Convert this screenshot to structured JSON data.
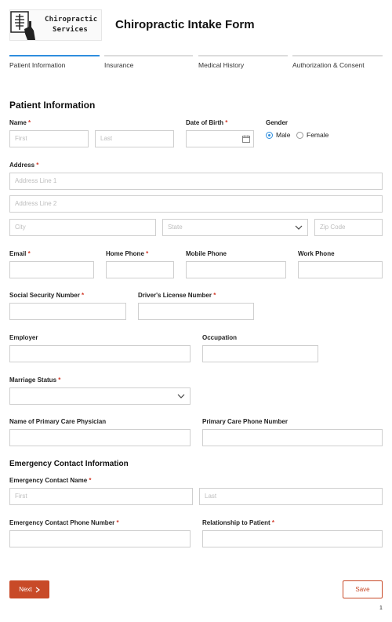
{
  "header": {
    "logo_line1": "Chiropractic",
    "logo_line2": "Services",
    "title": "Chiropractic Intake Form"
  },
  "tabs": [
    {
      "label": "Patient Information",
      "active": true
    },
    {
      "label": "Insurance",
      "active": false
    },
    {
      "label": "Medical History",
      "active": false
    },
    {
      "label": "Authorization & Consent",
      "active": false
    }
  ],
  "section": {
    "title": "Patient Information",
    "emergency_title": "Emergency Contact Information"
  },
  "labels": {
    "name": "Name",
    "dob": "Date of Birth",
    "gender": "Gender",
    "address": "Address",
    "email": "Email",
    "home_phone": "Home Phone",
    "mobile_phone": "Mobile Phone",
    "work_phone": "Work Phone",
    "ssn": "Social Security Number",
    "dl": "Driver's License Number",
    "employer": "Employer",
    "occupation": "Occupation",
    "marriage": "Marriage Status",
    "pcp_name": "Name of Primary Care Physician",
    "pcp_phone": "Primary Care Phone Number",
    "ec_name": "Emergency Contact Name",
    "ec_phone": "Emergency Contact Phone Number",
    "relationship": "Relationship to Patient",
    "required_mark": "*"
  },
  "placeholders": {
    "first": "First",
    "last": "Last",
    "address1": "Address Line 1",
    "address2": "Address Line 2",
    "city": "City",
    "state": "State",
    "zip": "Zip Code",
    "ec_first": "First",
    "ec_last": "Last"
  },
  "gender_options": {
    "male": "Male",
    "female": "Female",
    "selected": "Male"
  },
  "buttons": {
    "next": "Next",
    "save": "Save"
  },
  "footer": {
    "page_number": "1"
  },
  "colors": {
    "accent": "#2f8ede",
    "primary_button": "#c84a28",
    "required": "#d23a2a"
  }
}
